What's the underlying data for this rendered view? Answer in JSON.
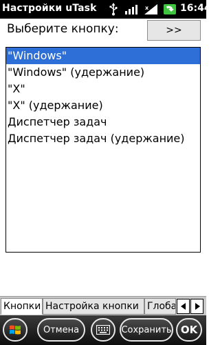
{
  "status_bar": {
    "title": "Настройки uTask",
    "time": "16:44",
    "icons": [
      "usb-icon",
      "signal-bars-icon",
      "cellular-signal-icon",
      "battery-charging-icon"
    ]
  },
  "header": {
    "prompt": "Выберите кнопку:",
    "next_button": ">>"
  },
  "list": {
    "selected_index": 0,
    "items": [
      "\"Windows\"",
      "\"Windows\" (удержание)",
      "\"X\"",
      "\"X\" (удержание)",
      "Диспетчер задач",
      "Диспетчер задач (удержание)"
    ]
  },
  "tabs": {
    "items": [
      "Кнопки",
      "Настройка кнопки",
      "Глоба"
    ],
    "active_index": 0
  },
  "command_bar": {
    "cancel": "Отмена",
    "save": "Сохранить",
    "ok": "OK"
  },
  "colors": {
    "selection": "#2d6fd6",
    "status_bar": "#000000",
    "battery_green": "#3ec43e"
  }
}
